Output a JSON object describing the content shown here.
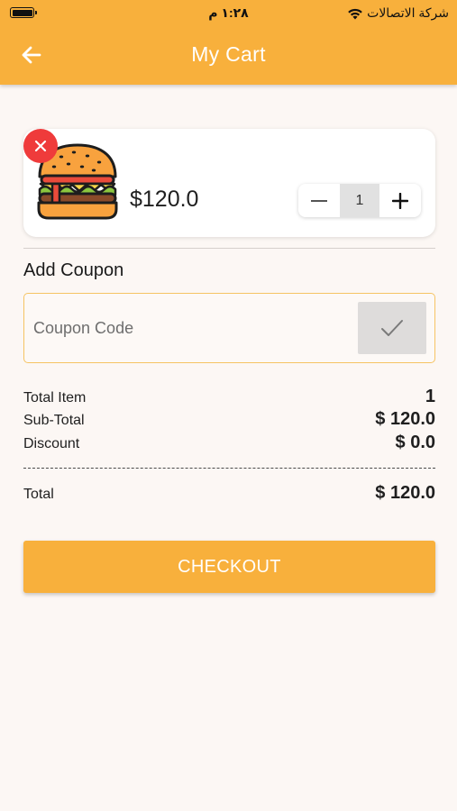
{
  "status_bar": {
    "time": "١:٢٨ م",
    "carrier": "شركة الاتصالات"
  },
  "header": {
    "title": "My Cart",
    "back_icon": "arrow-left-icon"
  },
  "cart": {
    "items": [
      {
        "image_icon": "burger-icon",
        "price": "$120.0",
        "quantity": "1",
        "remove_icon": "close-icon",
        "decrement_icon": "minus-icon",
        "increment_icon": "plus-icon"
      }
    ]
  },
  "coupon": {
    "title": "Add Coupon",
    "placeholder": "Coupon Code",
    "value": "",
    "apply_icon": "check-icon"
  },
  "summary": {
    "total_item_label": "Total Item",
    "total_item_value": "1",
    "subtotal_label": "Sub-Total",
    "subtotal_value": "$ 120.0",
    "discount_label": "Discount",
    "discount_value": "$ 0.0",
    "total_label": "Total",
    "total_value": "$ 120.0"
  },
  "checkout": {
    "label": "CHECKOUT"
  },
  "colors": {
    "accent": "#f8b03c",
    "remove": "#ef3b3b",
    "background": "#fcf7f4"
  }
}
